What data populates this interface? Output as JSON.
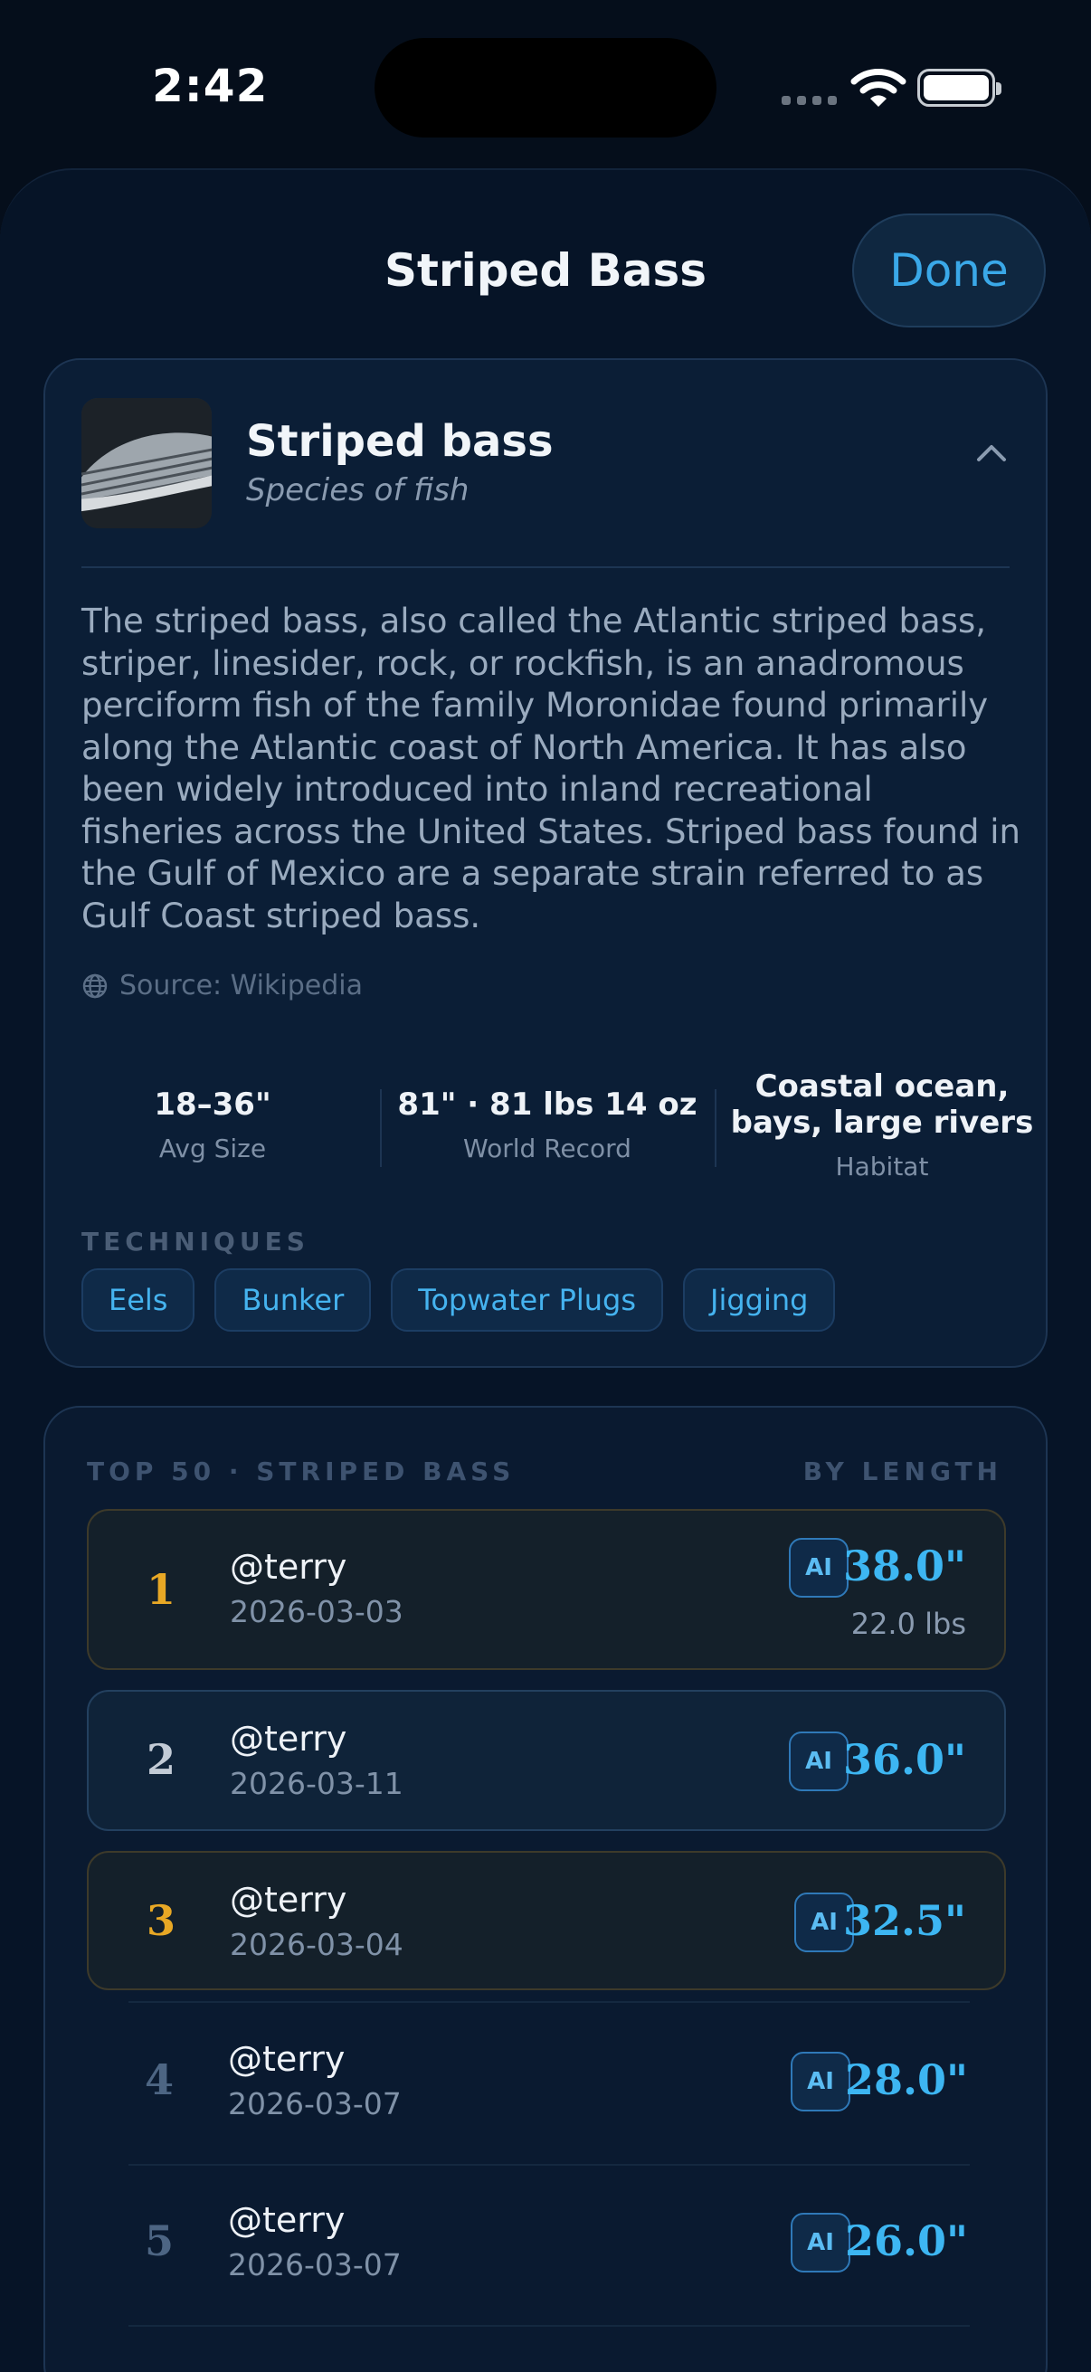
{
  "status_bar": {
    "time": "2:42"
  },
  "sheet": {
    "title": "Striped Bass",
    "done_label": "Done"
  },
  "species": {
    "name": "Striped bass",
    "subtitle": "Species of fish",
    "description": "The striped bass, also called the Atlantic striped bass, striper, linesider, rock, or rockfish, is an anadromous perciform fish of the family Moronidae found primarily along the Atlantic coast of North America. It has also been widely introduced into inland recreational fisheries across the United States. Striped bass found in the Gulf of Mexico are a separate strain referred to as Gulf Coast striped bass.",
    "source": "Source: Wikipedia",
    "stats": [
      {
        "value": "18–36\"",
        "label": "Avg Size"
      },
      {
        "value": "81\" · 81 lbs 14 oz",
        "label": "World Record"
      },
      {
        "value": "Coastal ocean, bays, large rivers",
        "label": "Habitat"
      }
    ],
    "techniques_label": "TECHNIQUES",
    "techniques": [
      "Eels",
      "Bunker",
      "Topwater Plugs",
      "Jigging"
    ]
  },
  "leaderboard": {
    "title": "TOP 50 · STRIPED BASS",
    "sort_label": "BY LENGTH",
    "badge": "AI",
    "rows": [
      {
        "rank": "1",
        "user": "@terry",
        "date": "2026-03-03",
        "length": "38.0\"",
        "weight": "22.0 lbs"
      },
      {
        "rank": "2",
        "user": "@terry",
        "date": "2026-03-11",
        "length": "36.0\""
      },
      {
        "rank": "3",
        "user": "@terry",
        "date": "2026-03-04",
        "length": "32.5\""
      },
      {
        "rank": "4",
        "user": "@terry",
        "date": "2026-03-07",
        "length": "28.0\""
      },
      {
        "rank": "5",
        "user": "@terry",
        "date": "2026-03-07",
        "length": "26.0\""
      }
    ]
  },
  "colors": {
    "accent": "#3db6f2",
    "gold": "#e8a825",
    "silver": "#c2cbd6",
    "muted": "#5b6e86"
  }
}
